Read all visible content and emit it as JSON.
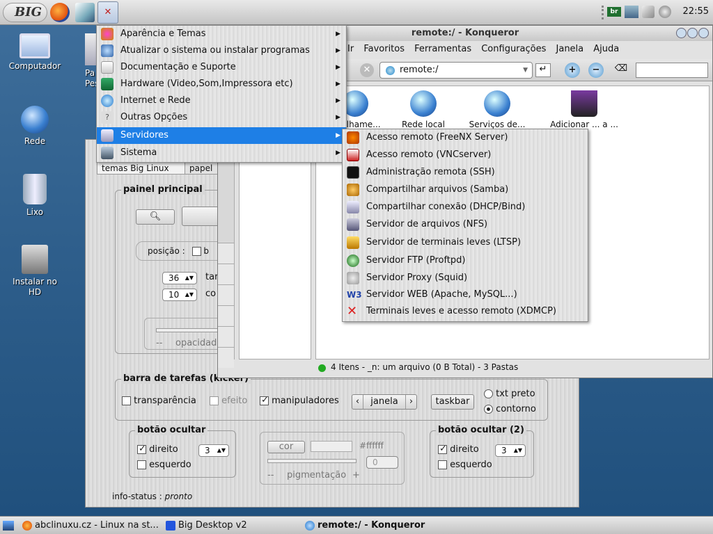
{
  "top_panel": {
    "logo": "BIG",
    "clock": "22:55",
    "tray_badge": "br"
  },
  "desktop_icons": [
    {
      "label": "Computador",
      "icon": "computer-icon"
    },
    {
      "label": "Rede",
      "icon": "network-globe-icon"
    },
    {
      "label": "Lixo",
      "icon": "trash-icon"
    },
    {
      "label": "Instalar no HD",
      "icon": "harddisk-icon"
    }
  ],
  "desktop_icon_partial": "Pa Pes",
  "main_menu": {
    "items": [
      {
        "label": "Aparência e Temas",
        "icon": "palette-icon"
      },
      {
        "label": "Atualizar o sistema ou instalar programas",
        "icon": "update-icon"
      },
      {
        "label": "Documentação e Suporte",
        "icon": "book-icon"
      },
      {
        "label": "Hardware (Video,Som,Impressora etc)",
        "icon": "hardware-icon"
      },
      {
        "label": "Internet e Rede",
        "icon": "internet-icon"
      },
      {
        "label": "Outras Opções",
        "icon": "question-icon"
      },
      {
        "label": "Servidores",
        "icon": "server-icon"
      },
      {
        "label": "Sistema",
        "icon": "system-icon"
      }
    ]
  },
  "submenu": {
    "items": [
      {
        "label": "Acesso remoto (FreeNX Server)",
        "icon": "antenna-icon"
      },
      {
        "label": "Acesso remoto (VNCserver)",
        "icon": "vnc-icon"
      },
      {
        "label": "Administração remota (SSH)",
        "icon": "terminal-icon"
      },
      {
        "label": "Compartilhar arquivos (Samba)",
        "icon": "samba-icon"
      },
      {
        "label": "Compartilhar conexão (DHCP/Bind)",
        "icon": "dhcp-icon"
      },
      {
        "label": "Servidor de arquivos (NFS)",
        "icon": "nfs-icon"
      },
      {
        "label": "Servidor de terminais leves (LTSP)",
        "icon": "ltsp-icon"
      },
      {
        "label": "Servidor FTP (Proftpd)",
        "icon": "ftp-icon"
      },
      {
        "label": "Servidor Proxy (Squid)",
        "icon": "squid-icon"
      },
      {
        "label": "Servidor WEB (Apache, MySQL...)",
        "icon": "w3-icon"
      },
      {
        "label": "Terminais leves e acesso remoto (XDMCP)",
        "icon": "x-icon"
      }
    ]
  },
  "konqueror": {
    "title": "remote:/ - Konqueror",
    "menu": [
      "Ir",
      "Favoritos",
      "Ferramentas",
      "Configurações",
      "Janela",
      "Ajuda"
    ],
    "location": "remote:/",
    "icons": [
      {
        "label": "...rtilhame..."
      },
      {
        "label": "Rede local"
      },
      {
        "label": "Serviços de..."
      },
      {
        "label": "Adicionar ... a ..."
      }
    ],
    "status": "4 Itens - _n: um arquivo (0 B Total) - 3 Pastas"
  },
  "bigdesktop": {
    "tabs": [
      "temas",
      "Big Linux",
      "papel"
    ],
    "painel_title": "painel principal",
    "posicao_label": "posição :",
    "posicao_value": "b",
    "spin_tam": "36",
    "spin_tam_label": "tar",
    "spin_cor": "10",
    "spin_cor_label": "co",
    "opacidade": "opacidade",
    "opacidade_minus": "--",
    "barra_title": "barra de tarefas (kicker)",
    "transparencia": "transparência",
    "efeito": "efeito",
    "manipuladores": "manipuladores",
    "janela": "janela",
    "taskbar": "taskbar",
    "txt_preto": "txt preto",
    "contorno": "contorno",
    "botao_ocultar": "botão ocultar",
    "botao_ocultar2": "botão ocultar (2)",
    "direito": "direito",
    "esquerdo": "esquerdo",
    "spin_left": "3",
    "spin_right": "3",
    "cor_btn": "cor",
    "cor_hex": "#ffffff",
    "pigmentacao": "pigmentação",
    "pig_minus": "--",
    "pig_plus": "+",
    "pig_spin": "0",
    "info_label": "info-status :",
    "info_value": "pronto"
  },
  "taskbar": {
    "tasks": [
      {
        "label": "abclinuxu.cz - Linux na st...",
        "icon": "firefox-icon"
      },
      {
        "label": "Big Desktop v2",
        "icon": "bigdesktop-icon"
      },
      {
        "label": "remote:/ - Konqueror",
        "icon": "konqueror-icon"
      }
    ]
  },
  "colors": {
    "selection": "#1e7fe6",
    "desktop": "#2f5f8c"
  }
}
